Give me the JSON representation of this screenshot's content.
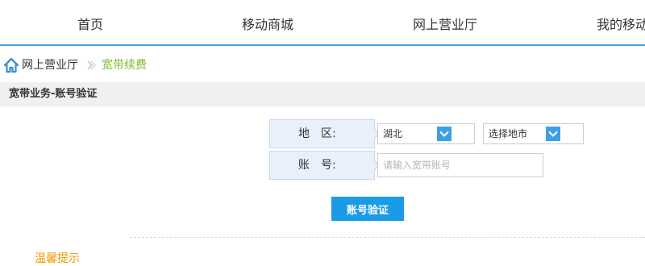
{
  "nav": {
    "items": [
      {
        "label": "首页"
      },
      {
        "label": "移动商城"
      },
      {
        "label": "网上营业厅"
      },
      {
        "label": "我的移动"
      }
    ]
  },
  "breadcrumb": {
    "home_icon": "home-icon",
    "home_label": "网上营业厅",
    "separator_icon": "double-chevron-right-icon",
    "current_label": "宽带续费"
  },
  "section": {
    "title": "宽带业务-账号验证"
  },
  "form": {
    "region_label": "地　区:",
    "province_value": "湖北",
    "city_value": "选择地市",
    "account_label": "账　号:",
    "account_placeholder": "请输入宽带账号",
    "account_value": "",
    "dropdown_icon": "chevron-down-icon",
    "submit_label": "账号验证"
  },
  "tips": {
    "title": "温馨提示"
  },
  "colors": {
    "accent": "#42a3e0",
    "button": "#1a9be6",
    "breadcrumb_current": "#7cb82f",
    "label_bg": "#e8f1fb",
    "tips": "#f39800"
  }
}
